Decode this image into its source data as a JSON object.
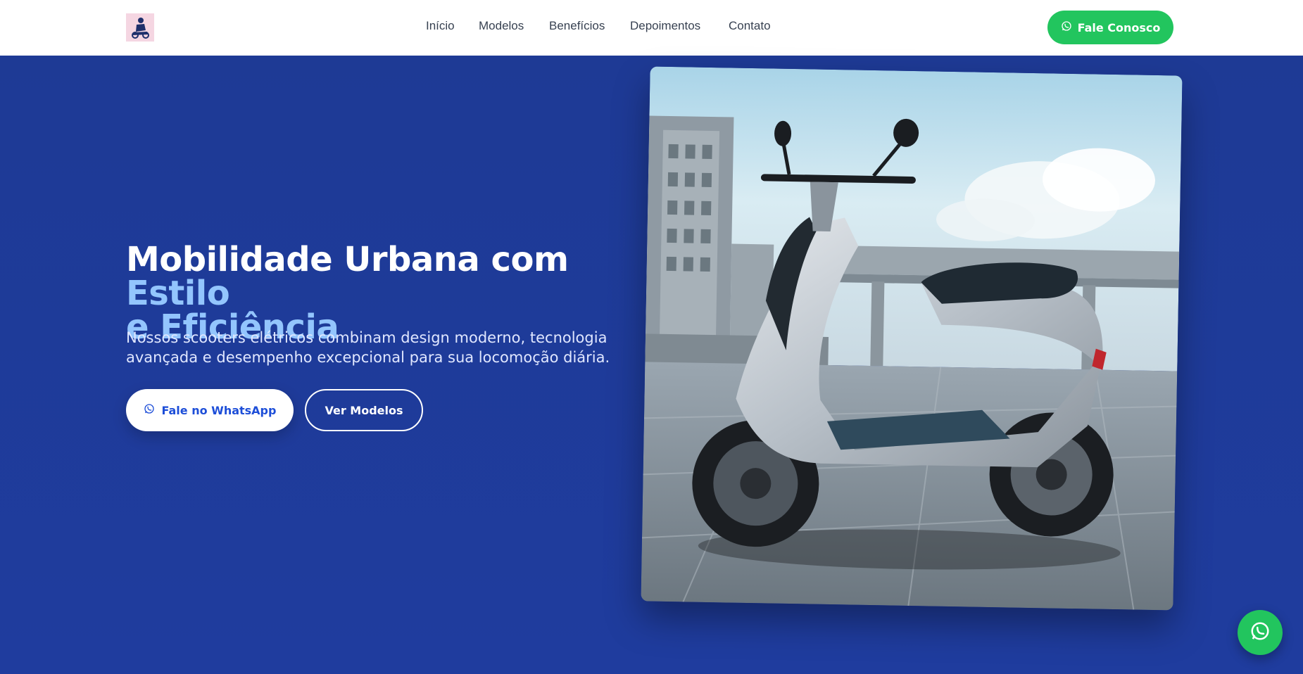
{
  "header": {
    "logo_alt": "scooter-logo",
    "nav": [
      {
        "label": "Início"
      },
      {
        "label": "Modelos"
      },
      {
        "label": "Benefícios"
      },
      {
        "label": "Depoimentos"
      },
      {
        "label": "Contato"
      }
    ],
    "cta_label": "Fale Conosco"
  },
  "hero": {
    "title_part1": "Mobilidade Urbana com ",
    "title_accent1": "Estilo",
    "title_accent2": "e Eficiência",
    "subtitle": "Nossos scooters elétricos combinam design moderno, tecnologia avançada e desempenho excepcional para sua locomoção diária.",
    "primary_button": "Fale no WhatsApp",
    "secondary_button": "Ver Modelos"
  },
  "icons": {
    "whatsapp": "whatsapp-icon",
    "logo": "scooter-logo-icon"
  },
  "colors": {
    "brand_blue": "#1e3a9a",
    "accent_light_blue": "#93c5fd",
    "whatsapp_green": "#22c55e",
    "white": "#ffffff"
  }
}
